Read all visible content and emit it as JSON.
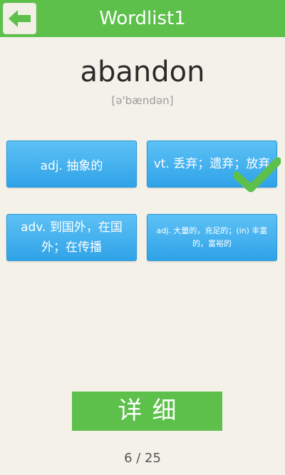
{
  "header": {
    "title": "Wordlist1",
    "back_icon": "arrow-left-icon"
  },
  "word": {
    "text": "abandon",
    "phonetic": "[ə'bændən]"
  },
  "options": [
    {
      "label": "adj. 抽象的",
      "correct": false
    },
    {
      "label": "vt. 丢弃；遗弃；放弃",
      "correct": true
    },
    {
      "label": "adv. 到国外，在国外；在传播",
      "correct": false
    },
    {
      "label": "adj. 大量的，充足的；(in) 丰富的，富裕的",
      "correct": false
    }
  ],
  "correct_icon": "checkmark-icon",
  "detail_button": {
    "label": "详细"
  },
  "progress": {
    "text": "6 / 25",
    "current": 6,
    "total": 25
  },
  "colors": {
    "header": "#5cc04a",
    "option": "#3aaced",
    "check": "#5cc04a",
    "background": "#f4f1e9"
  }
}
